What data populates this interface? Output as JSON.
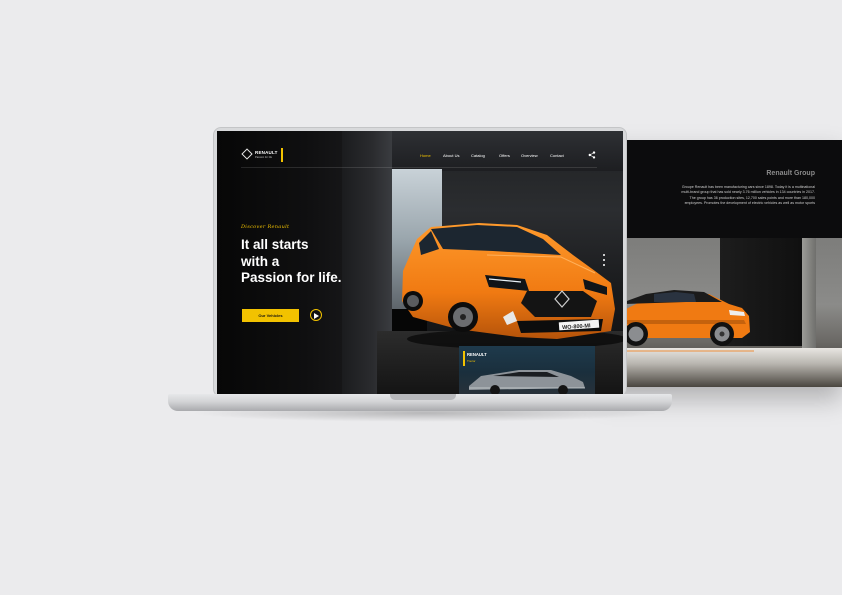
{
  "back_page": {
    "title": "Renault Group",
    "body": "Groupe Renault has been manufacturing cars since 1898. Today it is a multinational multi-brand group that has sold nearly 3.76 million vehicles in 134 countries in 2017. The group has 36 production sites, 12,700 sales points and more than 180,000 employees. Promotes the development of electric vehicles as well as motor sports"
  },
  "site": {
    "brand": "RENAULT",
    "brand_tagline": "Passion for life",
    "nav": [
      "Home",
      "About Us",
      "Catalog",
      "Offers",
      "Overview",
      "Contact"
    ],
    "active_nav": "Home",
    "hero": {
      "tagline": "Discover Renault",
      "headline_lines": [
        "It all starts",
        "with a",
        "Passion for life."
      ],
      "cta_label": "Our Vehicles"
    },
    "car_card": {
      "title": "RENAULT",
      "subtitle": "Trezor"
    },
    "license_plate": "WO-800-MI"
  },
  "colors": {
    "accent": "#f2c200",
    "car_orange": "#f07a12",
    "background": "#ebebed"
  },
  "icons": [
    "renault-logo-icon",
    "share-icon",
    "play-icon"
  ]
}
